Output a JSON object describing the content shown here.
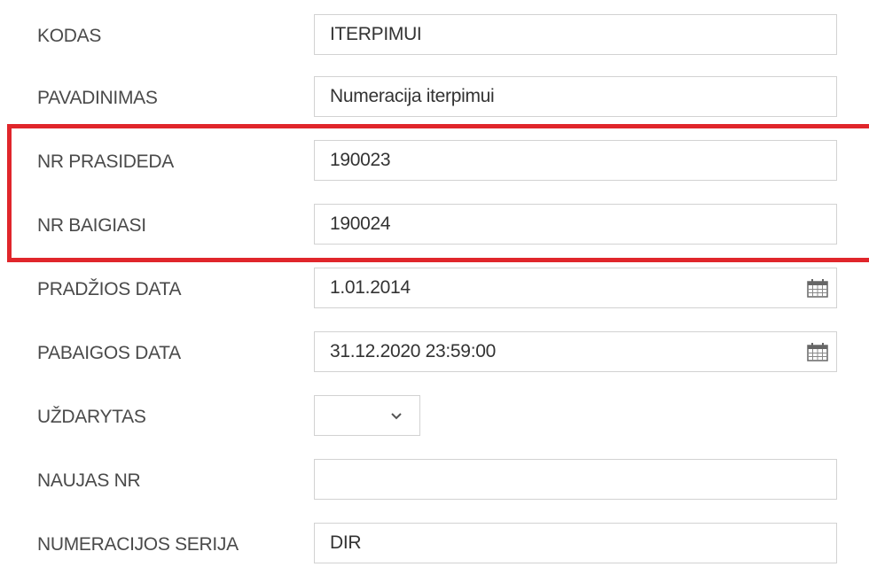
{
  "fields": [
    {
      "label": "KODAS",
      "value": "ITERPIMUI"
    },
    {
      "label": "PAVADINIMAS",
      "value": "Numeracija iterpimui"
    },
    {
      "label": "NR PRASIDEDA",
      "value": "190023"
    },
    {
      "label": "NR BAIGIASI",
      "value": "190024"
    },
    {
      "label": "PRADŽIOS DATA",
      "value": "1.01.2014"
    },
    {
      "label": "PABAIGOS DATA",
      "value": "31.12.2020 23:59:00"
    },
    {
      "label": "UŽDARYTAS",
      "value": ""
    },
    {
      "label": "NAUJAS NR",
      "value": ""
    },
    {
      "label": "NUMERACIJOS SERIJA",
      "value": "DIR"
    }
  ],
  "icons": {
    "calendar": "calendar-icon",
    "dropdown": "chevron-down-icon"
  },
  "colors": {
    "highlight": "#e0262b",
    "border": "#d2d2d2",
    "label": "#4a4a4a"
  }
}
